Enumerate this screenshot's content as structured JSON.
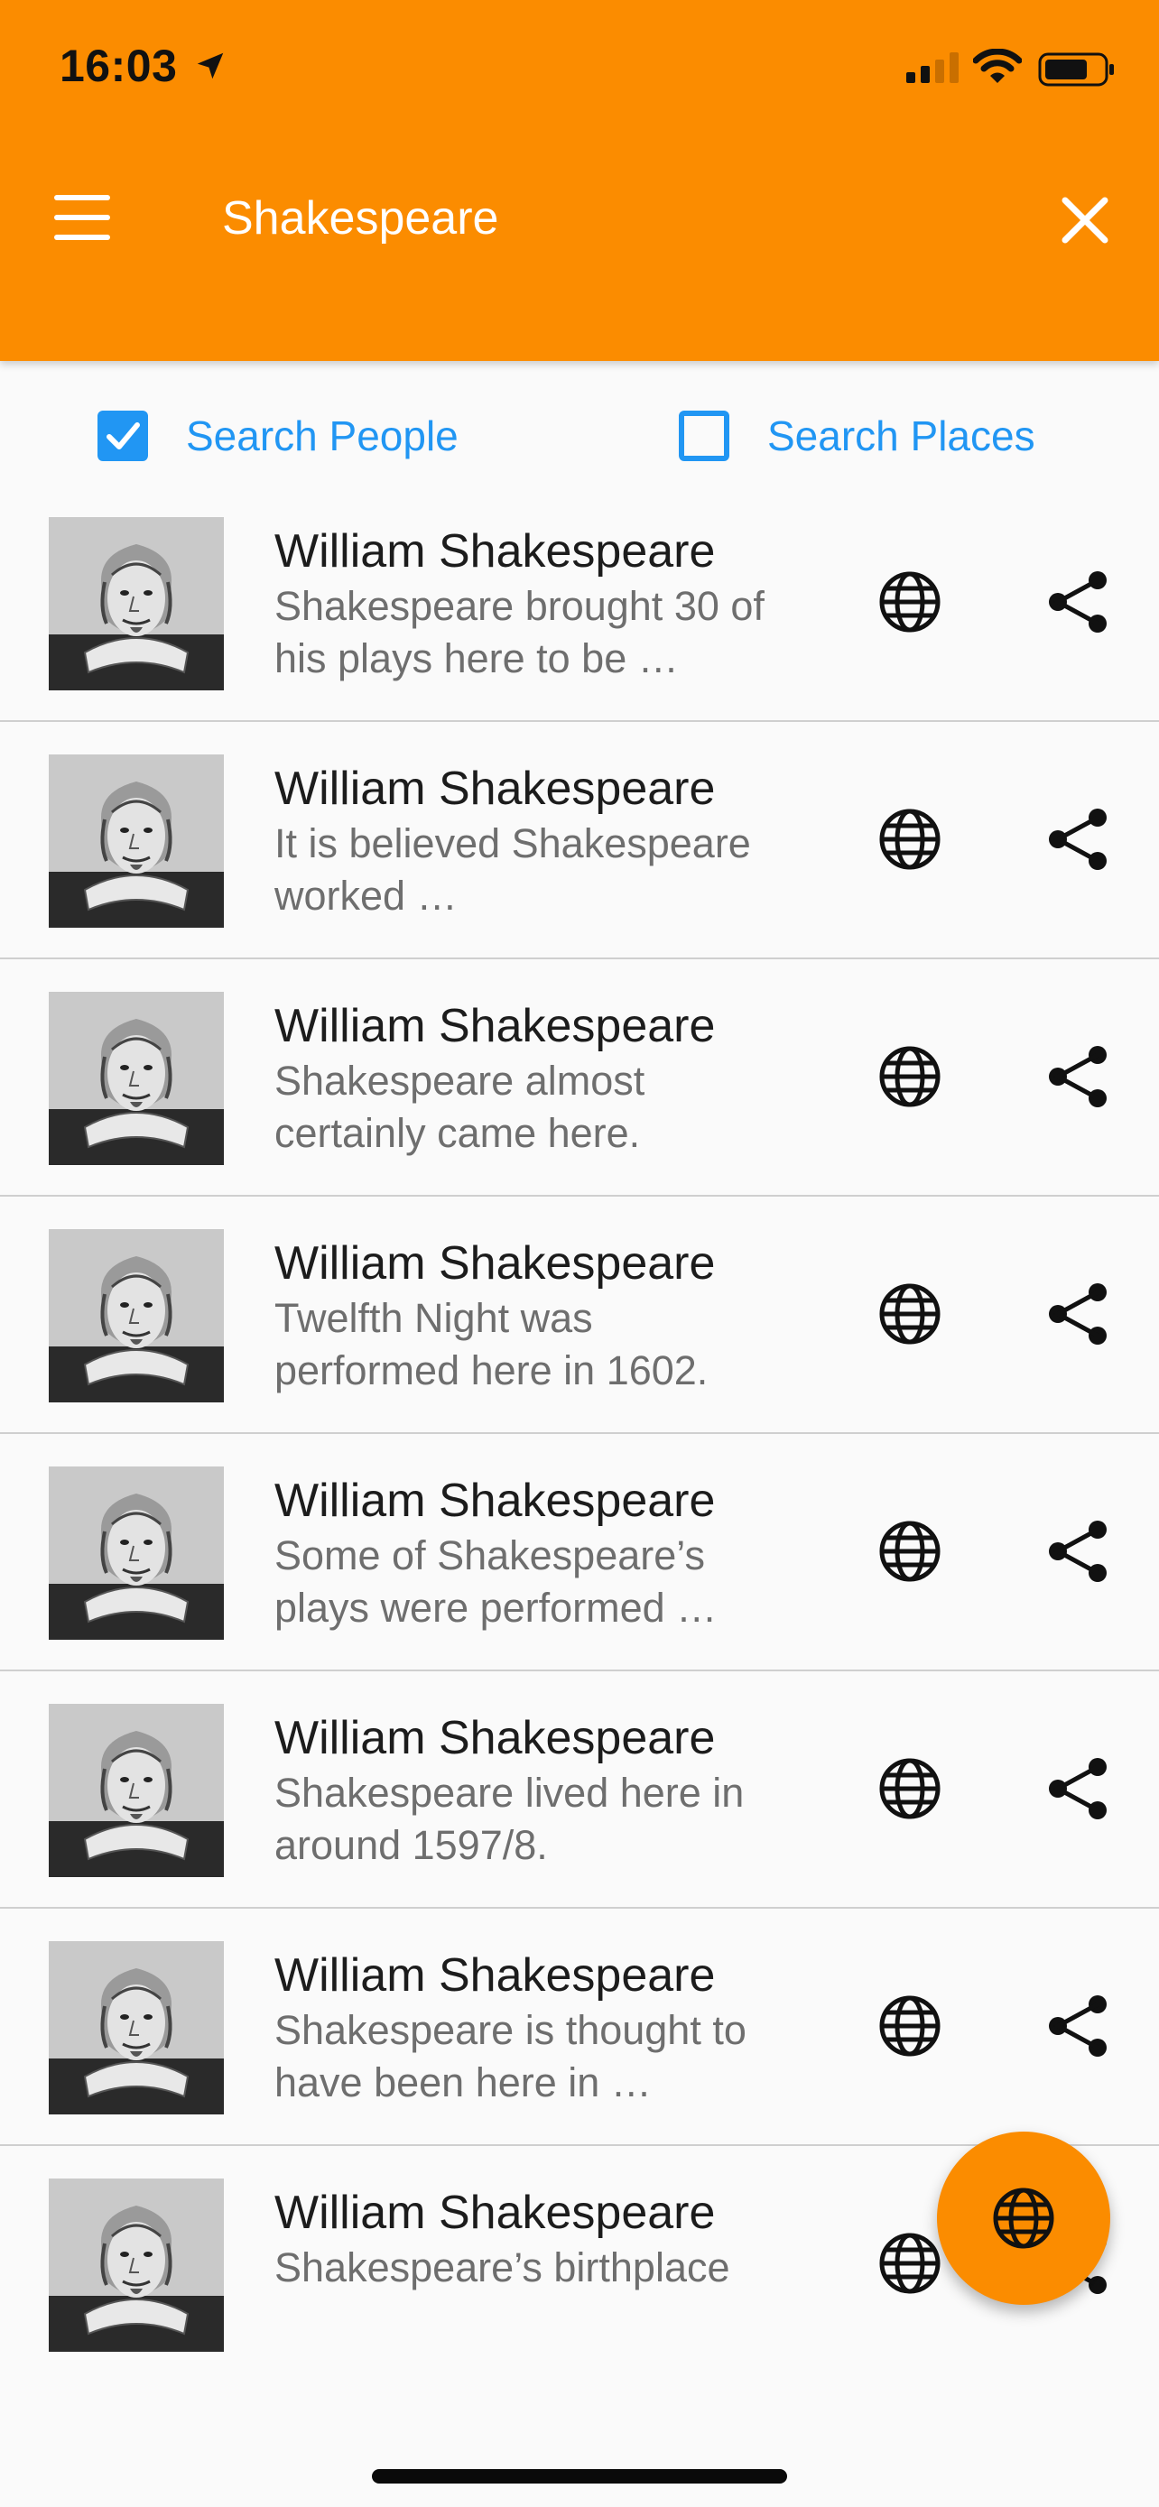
{
  "status_bar": {
    "time": "16:03"
  },
  "app_bar": {
    "title": "Shakespeare",
    "menu_icon": "menu-icon",
    "close_icon": "close-icon"
  },
  "filters": {
    "people": {
      "label": "Search People",
      "checked": true
    },
    "places": {
      "label": "Search Places",
      "checked": false
    }
  },
  "results": [
    {
      "title": "William Shakespeare",
      "description": "Shakespeare brought 30 of his plays here to be …"
    },
    {
      "title": "William Shakespeare",
      "description": "It is believed Shakespeare worked …"
    },
    {
      "title": "William Shakespeare",
      "description": "Shakespeare almost certainly came here."
    },
    {
      "title": "William Shakespeare",
      "description": "Twelfth Night was performed here in 1602."
    },
    {
      "title": "William Shakespeare",
      "description": "Some of Shakespeare’s plays were performed …"
    },
    {
      "title": "William Shakespeare",
      "description": "Shakespeare lived here in around 1597/8."
    },
    {
      "title": "William Shakespeare",
      "description": "Shakespeare is thought to have been here in …"
    },
    {
      "title": "William Shakespeare",
      "description": "Shakespeare’s birthplace"
    }
  ],
  "colors": {
    "accent": "#fb8c00",
    "link": "#2196f3"
  },
  "fab": {
    "icon": "globe-icon"
  }
}
